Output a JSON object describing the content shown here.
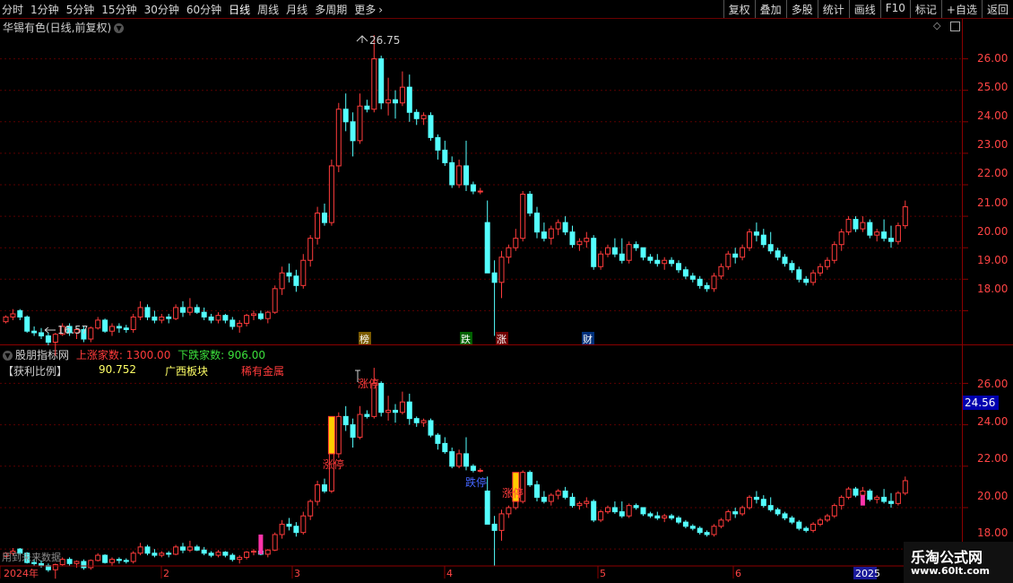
{
  "toolbar": {
    "periods": [
      "分时",
      "1分钟",
      "5分钟",
      "15分钟",
      "30分钟",
      "60分钟",
      "日线",
      "周线",
      "月线",
      "多周期",
      "更多"
    ],
    "active_period": "日线",
    "more_icon": "chevron-right-icon",
    "right_buttons": [
      "复权",
      "叠加",
      "多股",
      "统计",
      "画线",
      "F10",
      "标记",
      "+自选",
      "返回"
    ]
  },
  "main_panel": {
    "title": "华锡有色(日线,前复权)",
    "dropdown_icon": "chevron-down-icon",
    "diamond_icon": "diamond-icon",
    "pane_icon": "pane-icon",
    "y_ticks": [
      "26.00",
      "25.00",
      "24.00",
      "23.00",
      "22.00",
      "21.00",
      "20.00",
      "19.00",
      "18.00"
    ],
    "high_label": "26.75",
    "low_label": "16.57",
    "markers": [
      "榜",
      "跌",
      "涨",
      "财"
    ]
  },
  "indicator_panel": {
    "title": "股朋指标网",
    "up_label": "上涨家数: 1300.00",
    "down_label": "下跌家数: 906.00",
    "row2_name": "【获利比例】",
    "row2_value": "90.752",
    "row2_board": "广西板块",
    "row2_sector": "稀有金属",
    "y_ticks": [
      "26.00",
      "24.00",
      "22.00",
      "20.00",
      "18.00"
    ],
    "current_price": "24.56",
    "limit_up_label": "涨停",
    "limit_down_label": "跌停",
    "footer_note": "用到未来数据"
  },
  "x_axis": {
    "labels": [
      "2024年",
      "2",
      "3",
      "4",
      "5",
      "6"
    ],
    "year_badge": "2025"
  },
  "watermark": {
    "title": "乐淘公式网",
    "url": "www.60lt.com"
  },
  "colors": {
    "up": "#ff3b3b",
    "down": "#54ffff",
    "border": "#8b0000",
    "label_up": "#ff3b3b",
    "label_down": "#3be03b",
    "yellow": "#ffff00"
  },
  "chart_data": {
    "type": "candlestick",
    "ohlc": [
      [
        17.65,
        17.85,
        17.6,
        17.8
      ],
      [
        17.8,
        18.05,
        17.7,
        17.9
      ],
      [
        18.0,
        18.05,
        17.7,
        17.8
      ],
      [
        17.8,
        17.85,
        17.3,
        17.35
      ],
      [
        17.35,
        17.5,
        17.2,
        17.3
      ],
      [
        17.3,
        17.45,
        17.1,
        17.2
      ],
      [
        17.2,
        17.3,
        16.9,
        17.0
      ],
      [
        17.0,
        17.3,
        16.57,
        17.25
      ],
      [
        17.25,
        17.6,
        17.2,
        17.5
      ],
      [
        17.5,
        17.6,
        17.2,
        17.3
      ],
      [
        17.3,
        17.45,
        17.1,
        17.4
      ],
      [
        17.4,
        17.5,
        17.0,
        17.1
      ],
      [
        17.1,
        17.5,
        17.0,
        17.45
      ],
      [
        17.45,
        17.8,
        17.4,
        17.7
      ],
      [
        17.7,
        17.75,
        17.3,
        17.35
      ],
      [
        17.35,
        17.6,
        17.2,
        17.5
      ],
      [
        17.5,
        17.6,
        17.3,
        17.45
      ],
      [
        17.45,
        17.55,
        17.3,
        17.4
      ],
      [
        17.4,
        17.9,
        17.3,
        17.8
      ],
      [
        17.8,
        18.3,
        17.7,
        18.1
      ],
      [
        18.1,
        18.2,
        17.7,
        17.8
      ],
      [
        17.8,
        18.0,
        17.6,
        17.7
      ],
      [
        17.7,
        17.9,
        17.6,
        17.8
      ],
      [
        17.8,
        17.9,
        17.6,
        17.75
      ],
      [
        17.75,
        18.2,
        17.7,
        18.1
      ],
      [
        18.1,
        18.3,
        17.8,
        17.95
      ],
      [
        17.95,
        18.4,
        17.85,
        18.1
      ],
      [
        18.1,
        18.2,
        17.9,
        17.95
      ],
      [
        17.95,
        18.1,
        17.7,
        17.8
      ],
      [
        17.8,
        17.9,
        17.6,
        17.7
      ],
      [
        17.7,
        17.95,
        17.6,
        17.85
      ],
      [
        17.85,
        17.9,
        17.6,
        17.7
      ],
      [
        17.7,
        17.8,
        17.4,
        17.5
      ],
      [
        17.5,
        17.7,
        17.3,
        17.6
      ],
      [
        17.6,
        17.9,
        17.5,
        17.85
      ],
      [
        17.85,
        18.0,
        17.7,
        17.9
      ],
      [
        17.9,
        18.0,
        17.7,
        17.75
      ],
      [
        17.75,
        18.0,
        17.6,
        17.95
      ],
      [
        17.95,
        18.8,
        17.9,
        18.7
      ],
      [
        18.7,
        19.4,
        18.5,
        19.2
      ],
      [
        19.2,
        19.5,
        18.9,
        19.1
      ],
      [
        19.1,
        19.3,
        18.6,
        18.8
      ],
      [
        18.8,
        19.8,
        18.7,
        19.6
      ],
      [
        19.6,
        20.4,
        19.4,
        20.3
      ],
      [
        20.3,
        21.3,
        20.1,
        21.1
      ],
      [
        21.1,
        21.4,
        20.7,
        20.8
      ],
      [
        20.8,
        22.8,
        20.7,
        22.6
      ],
      [
        22.6,
        24.6,
        22.4,
        24.4
      ],
      [
        24.4,
        24.9,
        23.7,
        24.0
      ],
      [
        24.0,
        24.3,
        22.9,
        23.4
      ],
      [
        23.4,
        24.9,
        23.3,
        24.5
      ],
      [
        24.5,
        24.7,
        24.3,
        24.4
      ],
      [
        24.4,
        26.75,
        24.3,
        26.0
      ],
      [
        26.0,
        26.1,
        24.4,
        24.6
      ],
      [
        24.6,
        25.4,
        24.2,
        24.7
      ],
      [
        24.7,
        25.0,
        24.1,
        24.6
      ],
      [
        24.6,
        25.6,
        24.5,
        25.1
      ],
      [
        25.1,
        25.5,
        24.0,
        24.3
      ],
      [
        24.3,
        24.4,
        23.9,
        24.1
      ],
      [
        24.1,
        24.3,
        23.9,
        24.2
      ],
      [
        24.2,
        24.3,
        23.4,
        23.5
      ],
      [
        23.5,
        23.6,
        22.8,
        23.1
      ],
      [
        23.1,
        23.4,
        22.6,
        22.7
      ],
      [
        22.7,
        22.9,
        21.9,
        22.0
      ],
      [
        22.0,
        22.8,
        21.9,
        22.6
      ],
      [
        22.6,
        23.4,
        21.8,
        22.0
      ],
      [
        22.0,
        22.1,
        21.7,
        21.8
      ],
      [
        21.8,
        21.9,
        21.7,
        21.8
      ],
      [
        20.8,
        21.5,
        20.0,
        19.2
      ],
      [
        19.2,
        19.6,
        17.2,
        18.9
      ],
      [
        18.9,
        19.9,
        18.4,
        19.7
      ],
      [
        19.7,
        20.1,
        19.5,
        20.0
      ],
      [
        20.0,
        20.6,
        19.9,
        20.3
      ],
      [
        20.3,
        21.8,
        20.2,
        21.7
      ],
      [
        21.7,
        21.8,
        21.0,
        21.1
      ],
      [
        21.1,
        21.3,
        20.3,
        20.5
      ],
      [
        20.5,
        20.8,
        20.2,
        20.3
      ],
      [
        20.3,
        20.7,
        20.1,
        20.6
      ],
      [
        20.6,
        20.9,
        20.4,
        20.8
      ],
      [
        20.8,
        21.0,
        20.4,
        20.5
      ],
      [
        20.5,
        20.7,
        20.0,
        20.1
      ],
      [
        20.1,
        20.3,
        19.9,
        20.2
      ],
      [
        20.2,
        20.5,
        20.0,
        20.3
      ],
      [
        20.3,
        20.4,
        19.3,
        19.4
      ],
      [
        19.4,
        19.9,
        19.3,
        19.8
      ],
      [
        19.8,
        20.1,
        19.7,
        20.0
      ],
      [
        20.0,
        20.3,
        19.7,
        19.8
      ],
      [
        19.8,
        20.3,
        19.5,
        19.6
      ],
      [
        19.6,
        20.2,
        19.5,
        20.1
      ],
      [
        20.1,
        20.2,
        19.9,
        20.0
      ],
      [
        20.0,
        20.0,
        19.6,
        19.7
      ],
      [
        19.7,
        19.8,
        19.5,
        19.6
      ],
      [
        19.6,
        19.8,
        19.4,
        19.5
      ],
      [
        19.5,
        19.7,
        19.3,
        19.6
      ],
      [
        19.6,
        19.7,
        19.4,
        19.5
      ],
      [
        19.5,
        19.6,
        19.2,
        19.3
      ],
      [
        19.3,
        19.4,
        19.0,
        19.1
      ],
      [
        19.1,
        19.2,
        18.9,
        19.0
      ],
      [
        19.0,
        19.1,
        18.7,
        18.8
      ],
      [
        18.8,
        18.9,
        18.6,
        18.7
      ],
      [
        18.7,
        19.2,
        18.6,
        19.1
      ],
      [
        19.1,
        19.5,
        19.0,
        19.4
      ],
      [
        19.4,
        19.9,
        19.3,
        19.8
      ],
      [
        19.8,
        20.0,
        19.5,
        19.7
      ],
      [
        19.7,
        20.1,
        19.6,
        20.0
      ],
      [
        20.0,
        20.6,
        19.9,
        20.5
      ],
      [
        20.5,
        20.8,
        20.2,
        20.4
      ],
      [
        20.4,
        20.6,
        20.0,
        20.1
      ],
      [
        20.1,
        20.5,
        19.8,
        19.9
      ],
      [
        19.9,
        20.0,
        19.6,
        19.7
      ],
      [
        19.7,
        19.8,
        19.4,
        19.5
      ],
      [
        19.5,
        19.6,
        19.2,
        19.3
      ],
      [
        19.3,
        19.4,
        18.9,
        19.0
      ],
      [
        19.0,
        19.1,
        18.8,
        18.9
      ],
      [
        18.9,
        19.3,
        18.8,
        19.2
      ],
      [
        19.2,
        19.5,
        19.1,
        19.4
      ],
      [
        19.4,
        19.7,
        19.3,
        19.6
      ],
      [
        19.6,
        20.2,
        19.5,
        20.1
      ],
      [
        20.1,
        20.6,
        19.9,
        20.5
      ],
      [
        20.5,
        21.0,
        20.4,
        20.9
      ],
      [
        20.9,
        21.0,
        20.5,
        20.6
      ],
      [
        20.6,
        21.0,
        20.5,
        20.8
      ],
      [
        20.8,
        20.9,
        20.3,
        20.4
      ],
      [
        20.4,
        20.6,
        20.2,
        20.5
      ],
      [
        20.5,
        20.9,
        20.2,
        20.3
      ],
      [
        20.3,
        20.7,
        20.0,
        20.2
      ],
      [
        20.2,
        20.8,
        20.1,
        20.7
      ],
      [
        20.7,
        21.5,
        20.6,
        21.3
      ]
    ],
    "y_range_main": [
      17.1,
      26.9
    ],
    "y_range_indicator": [
      17.4,
      27.1
    ]
  }
}
